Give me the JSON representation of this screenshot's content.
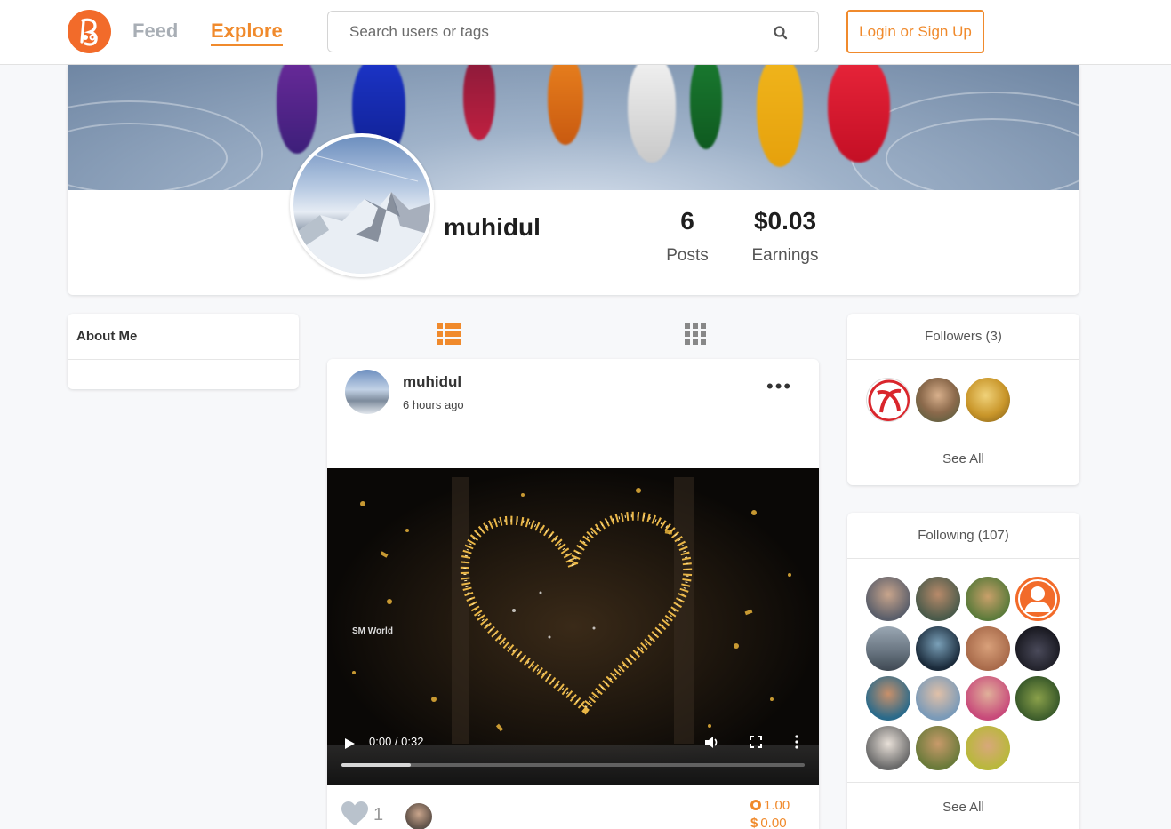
{
  "header": {
    "logo_icon": "brand-logo-icon",
    "nav": [
      {
        "label": "Feed",
        "active": false
      },
      {
        "label": "Explore",
        "active": true
      }
    ],
    "search": {
      "placeholder": "Search users or tags",
      "value": ""
    },
    "login_label": "Login or Sign Up"
  },
  "colors": {
    "accent": "#f08a2c",
    "logo_bg": "#f26b2a",
    "nav_inactive": "#a8aeb5"
  },
  "profile": {
    "username": "muhidul",
    "stats": [
      {
        "value": "6",
        "label": "Posts"
      },
      {
        "value": "$0.03",
        "label": "Earnings"
      }
    ]
  },
  "about": {
    "title": "About Me"
  },
  "view_toggle": {
    "list_icon": "list-view-icon",
    "grid_icon": "grid-view-icon",
    "active": "list"
  },
  "post": {
    "author": "muhidul",
    "time": "6 hours ago",
    "video": {
      "watermark": "SM World",
      "time": "0:00 / 0:32",
      "buffered": 0.15
    },
    "likes": "1",
    "rewards": {
      "coins": "1.00",
      "dollars": "0.00"
    }
  },
  "followers": {
    "title": "Followers (3)",
    "see_all": "See All"
  },
  "following": {
    "title": "Following (107)",
    "see_all": "See All"
  }
}
